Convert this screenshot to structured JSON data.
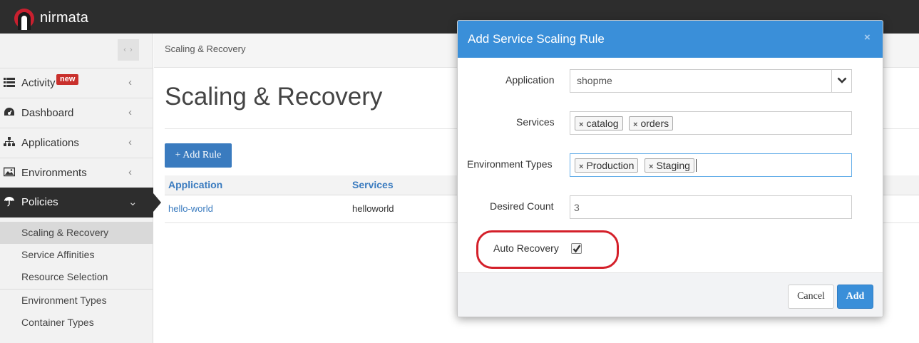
{
  "app": {
    "brand": "nirmata"
  },
  "sidebar": {
    "collapse_glyph": "‹ ›",
    "items": [
      {
        "label": "Activity",
        "icon": "list-icon",
        "badge": "new",
        "chevron": "‹"
      },
      {
        "label": "Dashboard",
        "icon": "dashboard-icon",
        "chevron": "‹"
      },
      {
        "label": "Applications",
        "icon": "sitemap-icon",
        "chevron": "‹"
      },
      {
        "label": "Environments",
        "icon": "image-icon",
        "chevron": "‹"
      },
      {
        "label": "Policies",
        "icon": "umbrella-icon",
        "chevron": "⌄",
        "active": true
      }
    ],
    "subitems": [
      {
        "label": "Scaling & Recovery",
        "selected": true
      },
      {
        "label": "Service Affinities"
      },
      {
        "label": "Resource Selection"
      },
      {
        "label": "Environment Types"
      },
      {
        "label": "Container Types"
      }
    ]
  },
  "breadcrumb": "Scaling & Recovery",
  "page": {
    "title": "Scaling & Recovery",
    "add_rule_label": "+ Add Rule",
    "table": {
      "headers": [
        "Application",
        "Services"
      ],
      "rows": [
        [
          "hello-world",
          "helloworld"
        ]
      ]
    }
  },
  "modal": {
    "title": "Add Service Scaling Rule",
    "close": "×",
    "application_label": "Application",
    "application_value": "shopme",
    "services_label": "Services",
    "services_tags": [
      "catalog",
      "orders"
    ],
    "env_types_label": "Environment Types",
    "env_types_tags": [
      "Production",
      "Staging"
    ],
    "desired_count_label": "Desired Count",
    "desired_count_value": "3",
    "auto_recovery_label": "Auto Recovery",
    "auto_recovery_checked": true,
    "tag_remove_glyph": "×",
    "cancel_label": "Cancel",
    "add_label": "Add"
  },
  "colors": {
    "accent": "#3a8fd9",
    "topbar": "#2d2d2d",
    "highlight": "#d4202a",
    "badge": "#c9302c"
  }
}
